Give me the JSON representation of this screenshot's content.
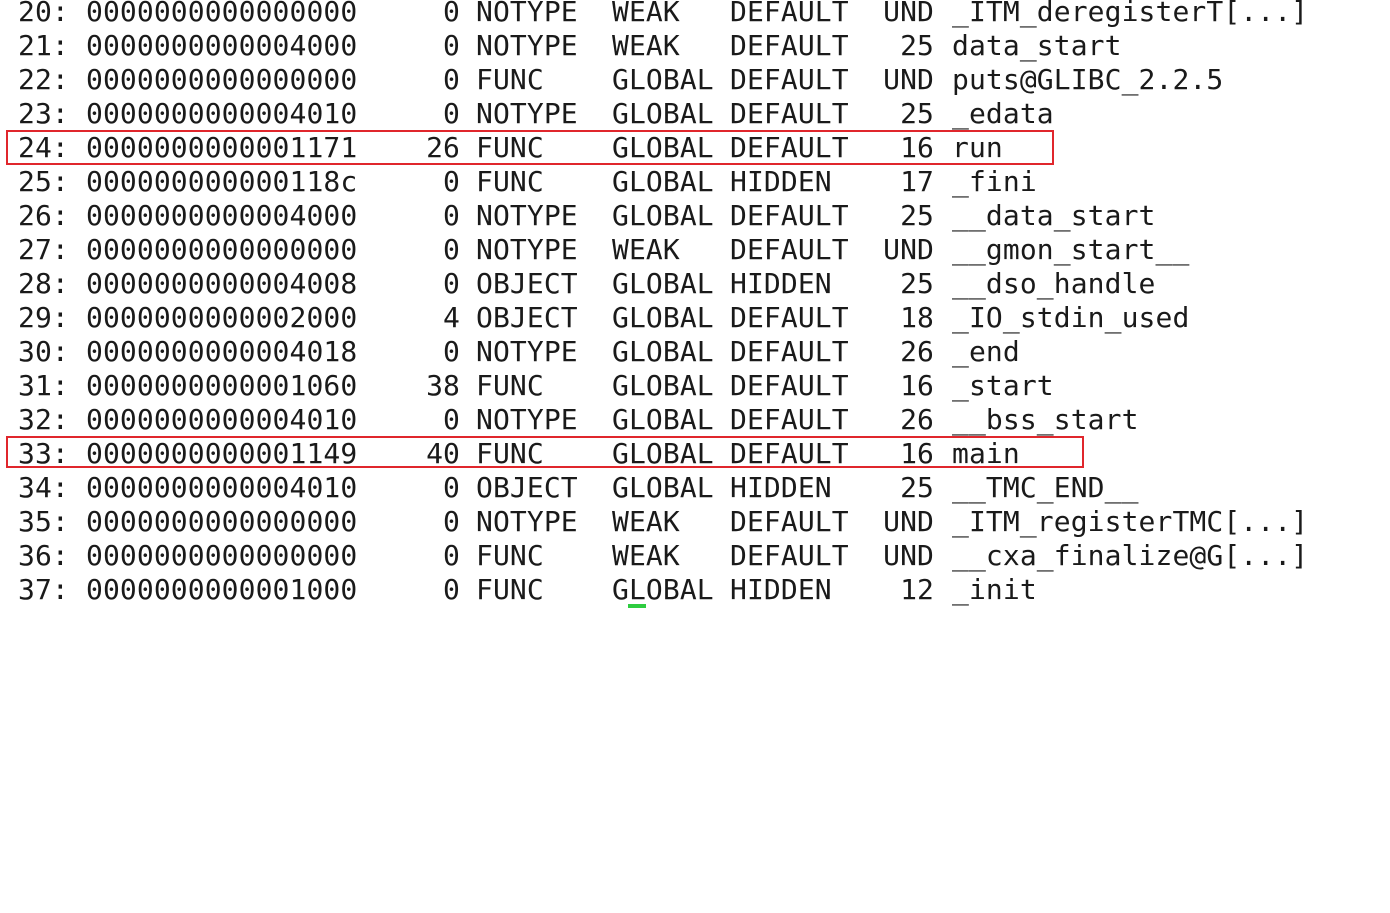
{
  "terminal": {
    "rows": [
      {
        "num": "20:",
        "value": "0000000000000000",
        "size": "0",
        "type": "NOTYPE",
        "bind": "WEAK",
        "vis": "DEFAULT",
        "ndx": "UND",
        "name": "_ITM_deregisterT[...]"
      },
      {
        "num": "21:",
        "value": "0000000000004000",
        "size": "0",
        "type": "NOTYPE",
        "bind": "WEAK",
        "vis": "DEFAULT",
        "ndx": "25",
        "name": "data_start"
      },
      {
        "num": "22:",
        "value": "0000000000000000",
        "size": "0",
        "type": "FUNC",
        "bind": "GLOBAL",
        "vis": "DEFAULT",
        "ndx": "UND",
        "name": "puts@GLIBC_2.2.5"
      },
      {
        "num": "23:",
        "value": "0000000000004010",
        "size": "0",
        "type": "NOTYPE",
        "bind": "GLOBAL",
        "vis": "DEFAULT",
        "ndx": "25",
        "name": "_edata"
      },
      {
        "num": "24:",
        "value": "0000000000001171",
        "size": "26",
        "type": "FUNC",
        "bind": "GLOBAL",
        "vis": "DEFAULT",
        "ndx": "16",
        "name": "run"
      },
      {
        "num": "25:",
        "value": "000000000000118c",
        "size": "0",
        "type": "FUNC",
        "bind": "GLOBAL",
        "vis": "HIDDEN",
        "ndx": "17",
        "name": "_fini"
      },
      {
        "num": "26:",
        "value": "0000000000004000",
        "size": "0",
        "type": "NOTYPE",
        "bind": "GLOBAL",
        "vis": "DEFAULT",
        "ndx": "25",
        "name": "__data_start"
      },
      {
        "num": "27:",
        "value": "0000000000000000",
        "size": "0",
        "type": "NOTYPE",
        "bind": "WEAK",
        "vis": "DEFAULT",
        "ndx": "UND",
        "name": "__gmon_start__"
      },
      {
        "num": "28:",
        "value": "0000000000004008",
        "size": "0",
        "type": "OBJECT",
        "bind": "GLOBAL",
        "vis": "HIDDEN",
        "ndx": "25",
        "name": "__dso_handle"
      },
      {
        "num": "29:",
        "value": "0000000000002000",
        "size": "4",
        "type": "OBJECT",
        "bind": "GLOBAL",
        "vis": "DEFAULT",
        "ndx": "18",
        "name": "_IO_stdin_used"
      },
      {
        "num": "30:",
        "value": "0000000000004018",
        "size": "0",
        "type": "NOTYPE",
        "bind": "GLOBAL",
        "vis": "DEFAULT",
        "ndx": "26",
        "name": "_end"
      },
      {
        "num": "31:",
        "value": "0000000000001060",
        "size": "38",
        "type": "FUNC",
        "bind": "GLOBAL",
        "vis": "DEFAULT",
        "ndx": "16",
        "name": "_start"
      },
      {
        "num": "32:",
        "value": "0000000000004010",
        "size": "0",
        "type": "NOTYPE",
        "bind": "GLOBAL",
        "vis": "DEFAULT",
        "ndx": "26",
        "name": "__bss_start"
      },
      {
        "num": "33:",
        "value": "0000000000001149",
        "size": "40",
        "type": "FUNC",
        "bind": "GLOBAL",
        "vis": "DEFAULT",
        "ndx": "16",
        "name": "main"
      },
      {
        "num": "34:",
        "value": "0000000000004010",
        "size": "0",
        "type": "OBJECT",
        "bind": "GLOBAL",
        "vis": "HIDDEN",
        "ndx": "25",
        "name": "__TMC_END__"
      },
      {
        "num": "35:",
        "value": "0000000000000000",
        "size": "0",
        "type": "NOTYPE",
        "bind": "WEAK",
        "vis": "DEFAULT",
        "ndx": "UND",
        "name": "_ITM_registerTMC[...]"
      },
      {
        "num": "36:",
        "value": "0000000000000000",
        "size": "0",
        "type": "FUNC",
        "bind": "WEAK",
        "vis": "DEFAULT",
        "ndx": "UND",
        "name": "__cxa_finalize@G[...]"
      },
      {
        "num": "37:",
        "value": "0000000000001000",
        "size": "0",
        "type": "FUNC",
        "bind": "GLOBAL",
        "vis": "HIDDEN",
        "ndx": "12",
        "name": "_init"
      }
    ]
  },
  "colors": {
    "text": "#1a1a1a",
    "background": "#ffffff",
    "highlight_border": "#e0262c",
    "cursor": "#2ecc40"
  }
}
